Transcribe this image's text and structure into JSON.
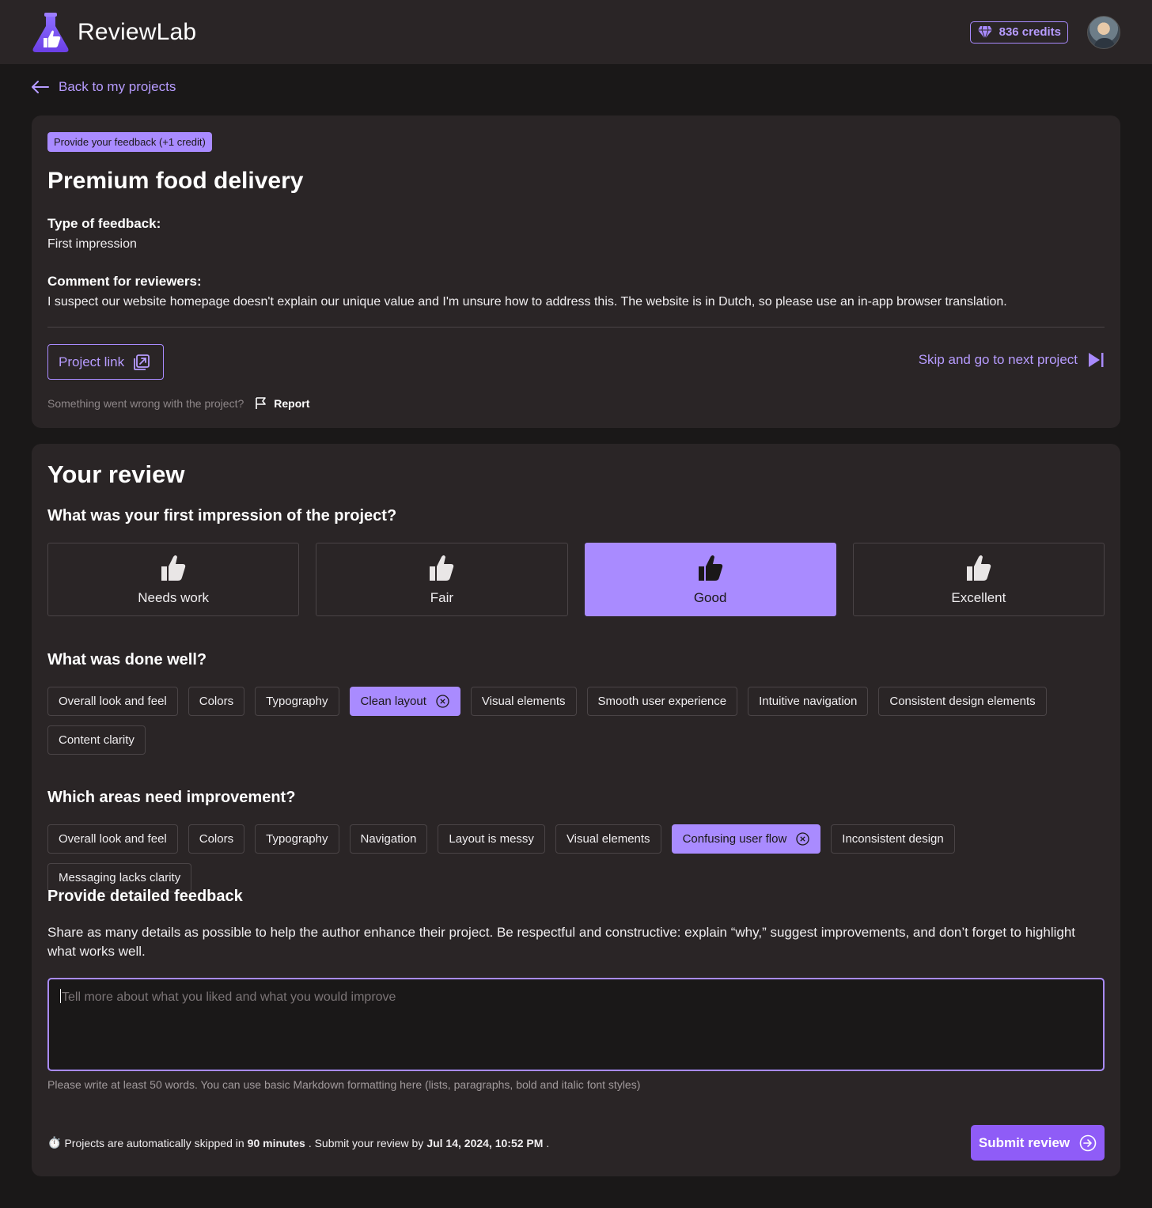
{
  "app": {
    "name": "ReviewLab",
    "accent": "#a98bff"
  },
  "header": {
    "credits_label": "836 credits",
    "credits_icon": "diamond-icon",
    "avatar": "user-avatar"
  },
  "nav": {
    "back_label": "Back to my projects"
  },
  "project": {
    "badge": "Provide your feedback (+1 credit)",
    "title": "Premium food delivery",
    "type_label": "Type of feedback:",
    "type_value": "First impression",
    "comment_label": "Comment for reviewers:",
    "comment_value": "I suspect our website homepage doesn't explain our unique value and I'm unsure how to address this. The website is in Dutch, so please use an in-app browser translation.",
    "link_label": "Project link",
    "skip_label": "Skip and go to next project",
    "report_question": "Something went wrong with the project?",
    "report_label": "Report"
  },
  "review": {
    "title": "Your review",
    "impression_question": "What was your first impression of the project?",
    "ratings": [
      {
        "label": "Needs work",
        "selected": false
      },
      {
        "label": "Fair",
        "selected": false
      },
      {
        "label": "Good",
        "selected": true
      },
      {
        "label": "Excellent",
        "selected": false
      }
    ],
    "done_well_question": "What was done well?",
    "done_well": [
      {
        "label": "Overall look and feel",
        "selected": false
      },
      {
        "label": "Colors",
        "selected": false
      },
      {
        "label": "Typography",
        "selected": false
      },
      {
        "label": "Clean layout",
        "selected": true
      },
      {
        "label": "Visual elements",
        "selected": false
      },
      {
        "label": "Smooth user experience",
        "selected": false
      },
      {
        "label": "Intuitive navigation",
        "selected": false
      },
      {
        "label": "Consistent design elements",
        "selected": false
      },
      {
        "label": "Content clarity",
        "selected": false
      }
    ],
    "improve_question": "Which areas need improvement?",
    "improve": [
      {
        "label": "Overall look and feel",
        "selected": false
      },
      {
        "label": "Colors",
        "selected": false
      },
      {
        "label": "Typography",
        "selected": false
      },
      {
        "label": "Navigation",
        "selected": false
      },
      {
        "label": "Layout is messy",
        "selected": false
      },
      {
        "label": "Visual elements",
        "selected": false
      },
      {
        "label": "Confusing user flow",
        "selected": true
      },
      {
        "label": "Inconsistent design",
        "selected": false
      },
      {
        "label": "Messaging lacks clarity",
        "selected": false
      }
    ],
    "detailed_title": "Provide detailed feedback",
    "detailed_desc": "Share as many details as possible to help the author enhance their project. Be respectful and constructive: explain “why,” suggest improvements, and don’t forget to highlight what works well.",
    "textarea_placeholder": "Tell more about what you liked and what you would improve",
    "hint": "Please write at least 50 words. You can use basic Markdown formatting here (lists, paragraphs, bold and italic font styles)",
    "footer": {
      "icon": "⏱️",
      "prefix": "Projects are automatically skipped in ",
      "duration": "90 minutes",
      "middle": ". Submit your review by ",
      "deadline": "Jul 14, 2024, 10:52 PM",
      "suffix": "."
    },
    "submit_label": "Submit review"
  }
}
